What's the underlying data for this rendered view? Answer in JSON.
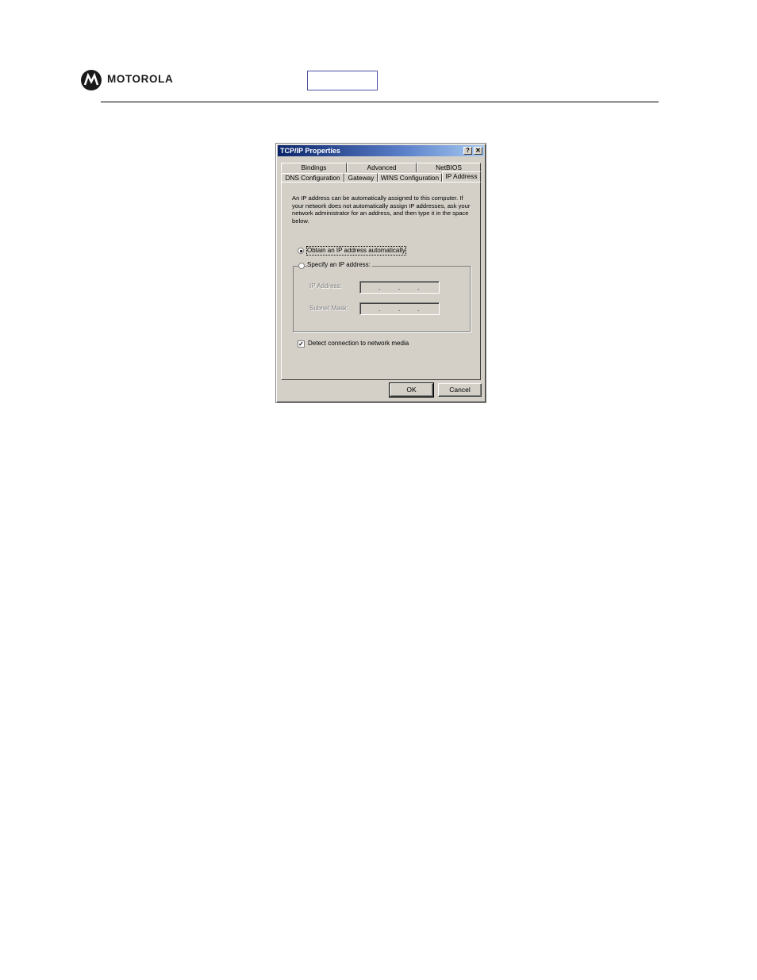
{
  "page": {
    "brand": "MOTOROLA"
  },
  "dialog": {
    "title": "TCP/IP Properties",
    "help_button": "?",
    "close_button": "✕",
    "tabs_row1": [
      "Bindings",
      "Advanced",
      "NetBIOS"
    ],
    "tabs_row2": [
      "DNS Configuration",
      "Gateway",
      "WINS Configuration",
      "IP Address"
    ],
    "active_tab": "IP Address",
    "description": "An IP address can be automatically assigned to this computer. If your network does not automatically assign IP addresses, ask your network administrator for an address, and then type it in the space below.",
    "obtain_auto_label": "Obtain an IP address automatically",
    "specify_label": "Specify an IP address:",
    "ip_address_label": "IP Address:",
    "subnet_mask_label": "Subnet Mask:",
    "detect_label": "Detect connection to network media",
    "detect_checked": true,
    "ok_label": "OK",
    "cancel_label": "Cancel"
  },
  "colors": {
    "dialog_face": "#d4d0c8",
    "title_start": "#0a246a",
    "title_end": "#a6caf0"
  }
}
